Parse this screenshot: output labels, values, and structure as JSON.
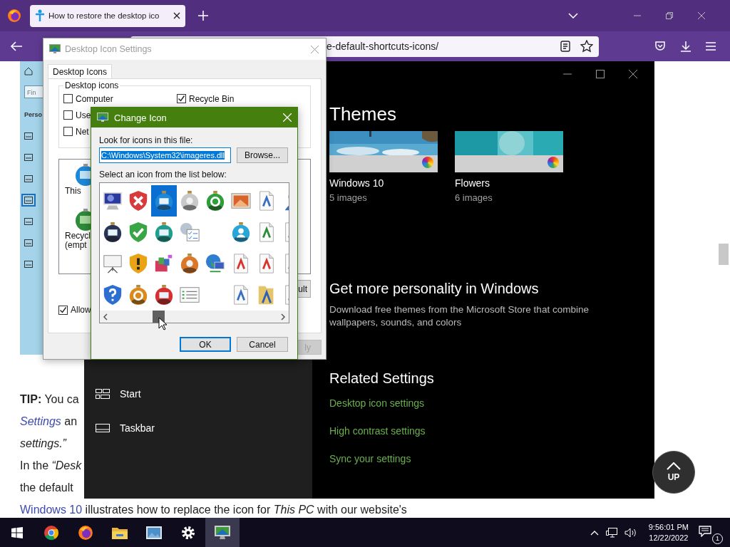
{
  "browser": {
    "tab": {
      "title": "How to restore the desktop ico",
      "selected": true
    },
    "url": "e-default-shortcuts-icons/"
  },
  "article": {
    "lines": [
      {
        "text": "**TIP:** You ca",
        "italic": false
      },
      {
        "link": "Settings",
        "link_italic": true,
        "text": " an",
        "italic": false
      },
      {
        "text": "settings.”",
        "italic": true
      },
      {
        "text": "In the *“Desk*",
        "italic": false
      },
      {
        "text": "the default",
        "italic": false
      },
      {
        "link": "Windows 10",
        "link_italic": false,
        "text": " illustrates how to replace the icon for *This PC* with our website's",
        "italic": false
      }
    ]
  },
  "side_strip": {
    "search_placeholder": "Fin",
    "section": "Perso"
  },
  "settings_window": {
    "nav": [
      {
        "label": "Start"
      },
      {
        "label": "Taskbar"
      }
    ],
    "heading": "Themes",
    "themes": [
      {
        "name": "Windows 10",
        "count": "5 images"
      },
      {
        "name": "Flowers",
        "count": "6 images"
      }
    ],
    "promo": {
      "title": "Get more personality in Windows",
      "text": "Download free themes from the Microsoft Store that combine wallpapers, sounds, and colors"
    },
    "related": {
      "title": "Related Settings",
      "links": [
        "Desktop icon settings",
        "High contrast settings",
        "Sync your settings"
      ]
    }
  },
  "up_button": "UP",
  "desktop_dialog": {
    "title": "Desktop Icon Settings",
    "tabs": [
      {
        "label": "Desktop Icons",
        "selected": true
      }
    ],
    "group": "Desktop icons",
    "checkboxes": [
      {
        "label": "Computer",
        "checked": false
      },
      {
        "label": "Use",
        "checked": false
      },
      {
        "label": "Net",
        "checked": false
      },
      {
        "label": "Recycle Bin",
        "checked": true
      }
    ],
    "icons": [
      {
        "lines": [
          "This"
        ]
      },
      {
        "lines": [
          "Recycl",
          "(empt"
        ]
      }
    ],
    "restore_button": "ult",
    "allow": {
      "label": "Allow",
      "checked": true
    },
    "apply": {
      "label": "ly",
      "disabled": true
    }
  },
  "change_icon": {
    "title": "Change Icon",
    "file_label": "Look for icons in this file:",
    "file_path": "C:\\Windows\\System32\\imageres.dll",
    "browse": "Browse...",
    "list_label": "Select an icon from the list below:",
    "icons": [
      {
        "kind": "icon",
        "selected": false
      },
      {
        "kind": "icon",
        "selected": false
      },
      {
        "kind": "icon",
        "selected": true
      },
      {
        "kind": "icon",
        "selected": false
      },
      {
        "kind": "icon",
        "selected": false
      },
      {
        "kind": "icon",
        "selected": false
      },
      {
        "kind": "icon",
        "selected": false
      },
      {
        "kind": "icon",
        "selected": false
      },
      {
        "kind": "icon",
        "selected": false
      },
      {
        "kind": "icon",
        "selected": false
      },
      {
        "kind": "icon",
        "selected": false
      },
      {
        "kind": "icon",
        "selected": false
      },
      {
        "kind": "blank"
      },
      {
        "kind": "icon",
        "selected": false
      },
      {
        "kind": "icon",
        "selected": false
      },
      {
        "kind": "icon",
        "selected": false
      },
      {
        "kind": "icon",
        "selected": false
      },
      {
        "kind": "icon",
        "selected": false
      },
      {
        "kind": "icon",
        "selected": false
      },
      {
        "kind": "icon",
        "selected": false
      },
      {
        "kind": "icon",
        "selected": false
      },
      {
        "kind": "icon",
        "selected": false
      },
      {
        "kind": "icon",
        "selected": false
      },
      {
        "kind": "icon",
        "selected": false
      },
      {
        "kind": "icon",
        "selected": false
      },
      {
        "kind": "icon",
        "selected": false
      },
      {
        "kind": "icon",
        "selected": false
      },
      {
        "kind": "icon",
        "selected": false
      },
      {
        "kind": "blank"
      },
      {
        "kind": "icon",
        "selected": false
      },
      {
        "kind": "icon",
        "selected": false
      },
      {
        "kind": "icon",
        "selected": false
      }
    ],
    "ok": "OK",
    "cancel": "Cancel"
  },
  "taskbar": {
    "apps": [
      {
        "active": false
      },
      {
        "active": false
      },
      {
        "active": false
      },
      {
        "active": false
      },
      {
        "active": false
      },
      {
        "active": true
      }
    ],
    "time": "9:56:01 PM",
    "date": "12/22/2022",
    "notifications": "1"
  }
}
